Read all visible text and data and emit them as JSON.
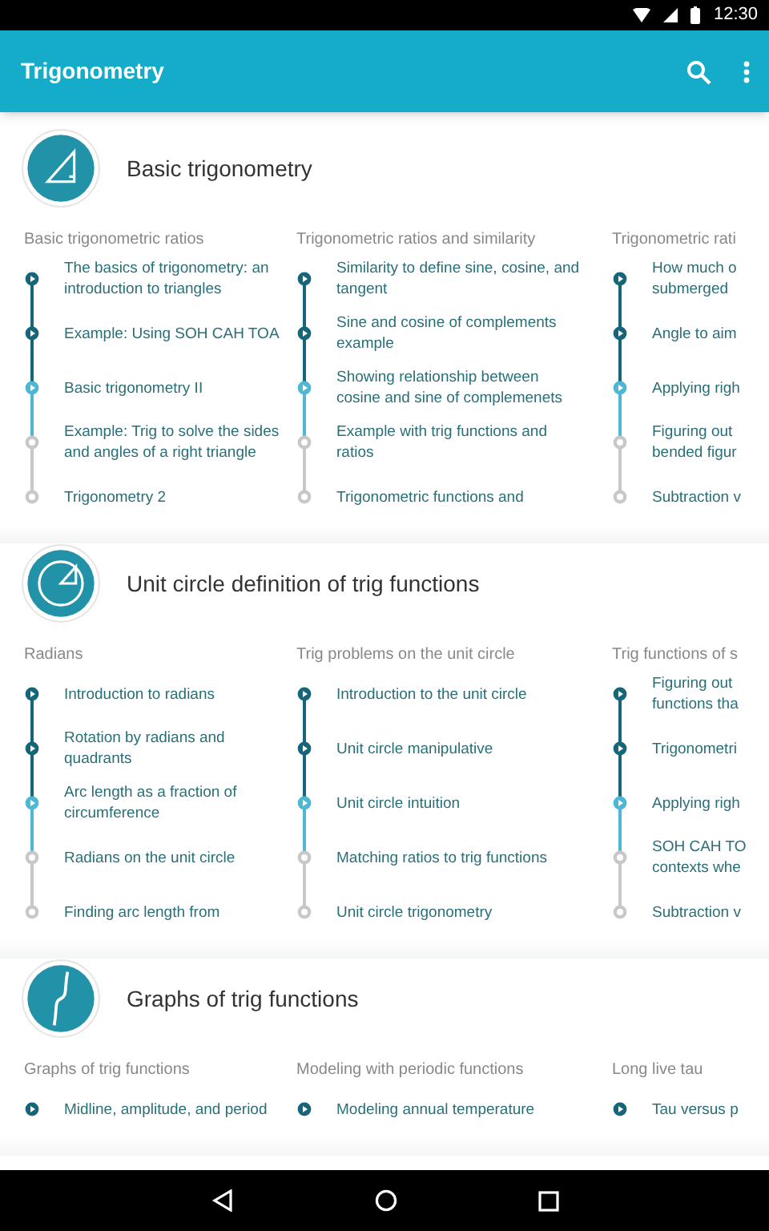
{
  "status_bar": {
    "time": "12:30"
  },
  "app_bar": {
    "title": "Trigonometry"
  },
  "sections": [
    {
      "title": "Basic trigonometry",
      "kind": "triangle",
      "columns": [
        {
          "title": "Basic trigonometric ratios",
          "items": [
            {
              "label": "The basics of trigonometry: an introduction to triangles",
              "kind": "started",
              "color": "#16667a"
            },
            {
              "label": "Example: Using SOH CAH TOA",
              "kind": "started",
              "color": "#16667a"
            },
            {
              "label": "Basic trigonometry II",
              "kind": "started",
              "color": "#4db8d4"
            },
            {
              "label": "Example: Trig to solve the sides and angles of a right triangle",
              "kind": "unstarted",
              "color": "#c8c8c8"
            },
            {
              "label": "Trigonometry 2",
              "kind": "unstarted",
              "color": "#c8c8c8"
            }
          ]
        },
        {
          "title": "Trigonometric ratios and similarity",
          "items": [
            {
              "label": "Similarity to define sine, cosine, and tangent",
              "kind": "started",
              "color": "#16667a"
            },
            {
              "label": "Sine and cosine of complements example",
              "kind": "started",
              "color": "#16667a"
            },
            {
              "label": "Showing relationship between cosine and sine of complemenets",
              "kind": "started",
              "color": "#4db8d4"
            },
            {
              "label": "Example with trig functions and ratios",
              "kind": "unstarted",
              "color": "#c8c8c8"
            },
            {
              "label": "Trigonometric functions and",
              "kind": "unstarted",
              "color": "#c8c8c8"
            }
          ]
        },
        {
          "title": "Trigonometric rati",
          "items": [
            {
              "label": "How much o\nsubmerged",
              "kind": "started",
              "color": "#16667a"
            },
            {
              "label": "Angle to aim",
              "kind": "started",
              "color": "#16667a"
            },
            {
              "label": "Applying righ",
              "kind": "started",
              "color": "#4db8d4"
            },
            {
              "label": "Figuring out\nbended figur",
              "kind": "unstarted",
              "color": "#c8c8c8"
            },
            {
              "label": "Subtraction v",
              "kind": "unstarted",
              "color": "#c8c8c8"
            }
          ]
        }
      ]
    },
    {
      "title": "Unit circle definition of trig functions",
      "kind": "circle",
      "columns": [
        {
          "title": "Radians",
          "items": [
            {
              "label": "Introduction to radians",
              "kind": "started",
              "color": "#16667a"
            },
            {
              "label": "Rotation by radians and quadrants",
              "kind": "started",
              "color": "#16667a"
            },
            {
              "label": "Arc length as a fraction of circumference",
              "kind": "started",
              "color": "#4db8d4"
            },
            {
              "label": "Radians on the unit circle",
              "kind": "unstarted",
              "color": "#c8c8c8"
            },
            {
              "label": "Finding arc length from",
              "kind": "unstarted",
              "color": "#c8c8c8"
            }
          ]
        },
        {
          "title": "Trig problems on the unit circle",
          "items": [
            {
              "label": "Introduction to the unit circle",
              "kind": "started",
              "color": "#16667a"
            },
            {
              "label": "Unit circle manipulative",
              "kind": "started",
              "color": "#16667a"
            },
            {
              "label": "Unit circle intuition",
              "kind": "started",
              "color": "#4db8d4"
            },
            {
              "label": "Matching ratios to trig functions",
              "kind": "unstarted",
              "color": "#c8c8c8"
            },
            {
              "label": "Unit circle trigonometry",
              "kind": "unstarted",
              "color": "#c8c8c8"
            }
          ]
        },
        {
          "title": "Trig functions of s",
          "items": [
            {
              "label": "Figuring out\nfunctions tha",
              "kind": "started",
              "color": "#16667a"
            },
            {
              "label": "Trigonometri",
              "kind": "started",
              "color": "#16667a"
            },
            {
              "label": "Applying righ",
              "kind": "started",
              "color": "#4db8d4"
            },
            {
              "label": "SOH CAH TO\ncontexts whe",
              "kind": "unstarted",
              "color": "#c8c8c8"
            },
            {
              "label": "Subtraction v",
              "kind": "unstarted",
              "color": "#c8c8c8"
            }
          ]
        }
      ]
    },
    {
      "title": "Graphs of trig functions",
      "kind": "wave",
      "columns": [
        {
          "title": "Graphs of trig functions",
          "items": [
            {
              "label": "Midline, amplitude, and period",
              "kind": "started",
              "color": "#16667a"
            }
          ]
        },
        {
          "title": "Modeling with periodic functions",
          "items": [
            {
              "label": "Modeling annual temperature",
              "kind": "started",
              "color": "#16667a"
            }
          ]
        },
        {
          "title": "Long live tau",
          "items": [
            {
              "label": "Tau versus p",
              "kind": "started",
              "color": "#16667a"
            }
          ]
        }
      ]
    }
  ]
}
